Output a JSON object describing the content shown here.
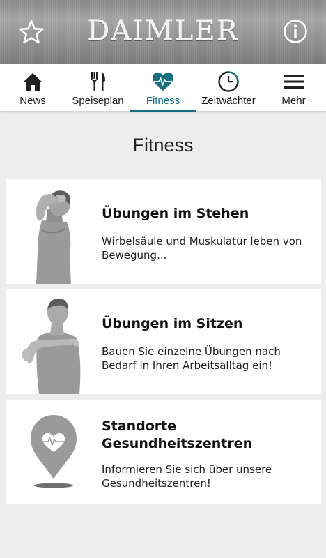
{
  "header": {
    "logo": "DAIMLER",
    "favorites_icon": "star-outline-icon",
    "info_icon": "info-circle-icon"
  },
  "tabs": [
    {
      "label": "News",
      "icon": "house-icon",
      "active": false
    },
    {
      "label": "Speiseplan",
      "icon": "cutlery-icon",
      "active": false
    },
    {
      "label": "Fitness",
      "icon": "heart-pulse-icon",
      "active": true
    },
    {
      "label": "Zeitwächter",
      "icon": "stopwatch-icon",
      "active": false
    },
    {
      "label": "Mehr",
      "icon": "hamburger-menu-icon",
      "active": false
    }
  ],
  "page": {
    "title": "Fitness"
  },
  "cards": [
    {
      "title": "Übungen im Stehen",
      "description": "Wirbelsäule und Muskulatur leben von Bewegung...",
      "illustration": "standing-stretch-figure"
    },
    {
      "title": "Übungen im Sitzen",
      "description": "Bauen Sie einzelne Übungen nach Bedarf in Ihren Arbeitsalltag ein!",
      "illustration": "seated-stretch-figure"
    },
    {
      "title": "Standorte Gesundheitszentren",
      "description": "Informieren Sie sich über unsere Gesundheitszentren!",
      "illustration": "heart-location-pin-icon"
    }
  ],
  "colors": {
    "accent": "#17707f",
    "header_gray": "#9a9a9a",
    "background": "#ededed"
  }
}
